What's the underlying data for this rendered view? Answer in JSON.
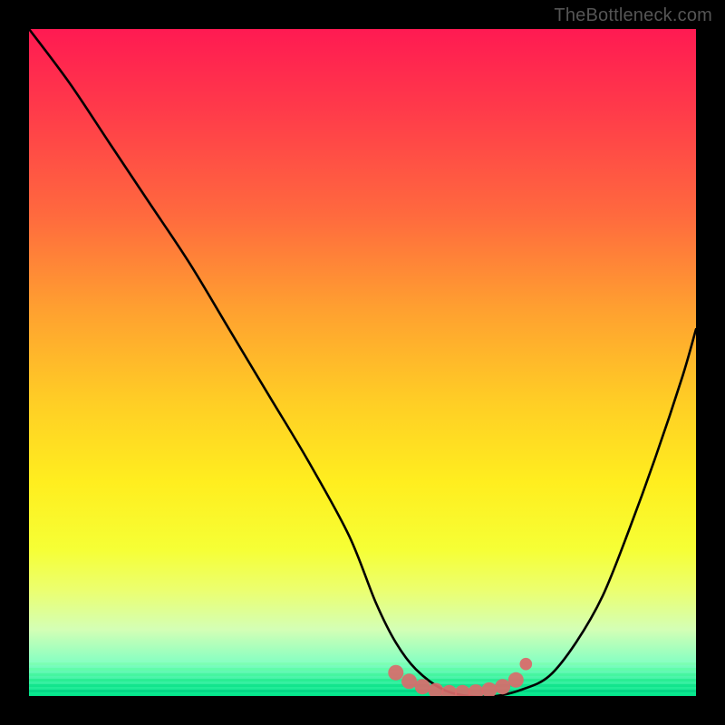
{
  "watermark": "TheBottleneck.com",
  "colors": {
    "background": "#000000",
    "curve": "#000000",
    "marker": "#d96b6b",
    "marker_stroke": "#d96b6b"
  },
  "chart_data": {
    "type": "line",
    "title": "",
    "xlabel": "",
    "ylabel": "",
    "xlim": [
      0,
      100
    ],
    "ylim": [
      0,
      100
    ],
    "grid": false,
    "series": [
      {
        "name": "bottleneck-curve",
        "x": [
          0,
          6,
          12,
          18,
          24,
          30,
          36,
          42,
          48,
          52,
          55,
          58,
          62,
          66,
          70,
          74,
          78,
          82,
          86,
          90,
          94,
          98,
          100
        ],
        "y": [
          100,
          92,
          83,
          74,
          65,
          55,
          45,
          35,
          24,
          14,
          8,
          4,
          1,
          0,
          0,
          1,
          3,
          8,
          15,
          25,
          36,
          48,
          55
        ]
      }
    ],
    "markers": {
      "name": "optimal-range",
      "x": [
        55,
        57,
        59,
        61,
        63,
        65,
        67,
        69,
        71,
        73,
        74.5
      ],
      "y": [
        3.5,
        2.2,
        1.4,
        0.8,
        0.5,
        0.5,
        0.6,
        0.9,
        1.4,
        2.4,
        4.8
      ]
    },
    "gradient_stops": [
      {
        "pos": 0.0,
        "color": "#ff1a52"
      },
      {
        "pos": 0.28,
        "color": "#ff6a3e"
      },
      {
        "pos": 0.56,
        "color": "#ffce25"
      },
      {
        "pos": 0.78,
        "color": "#f6ff35"
      },
      {
        "pos": 1.0,
        "color": "#00e58a"
      }
    ]
  }
}
